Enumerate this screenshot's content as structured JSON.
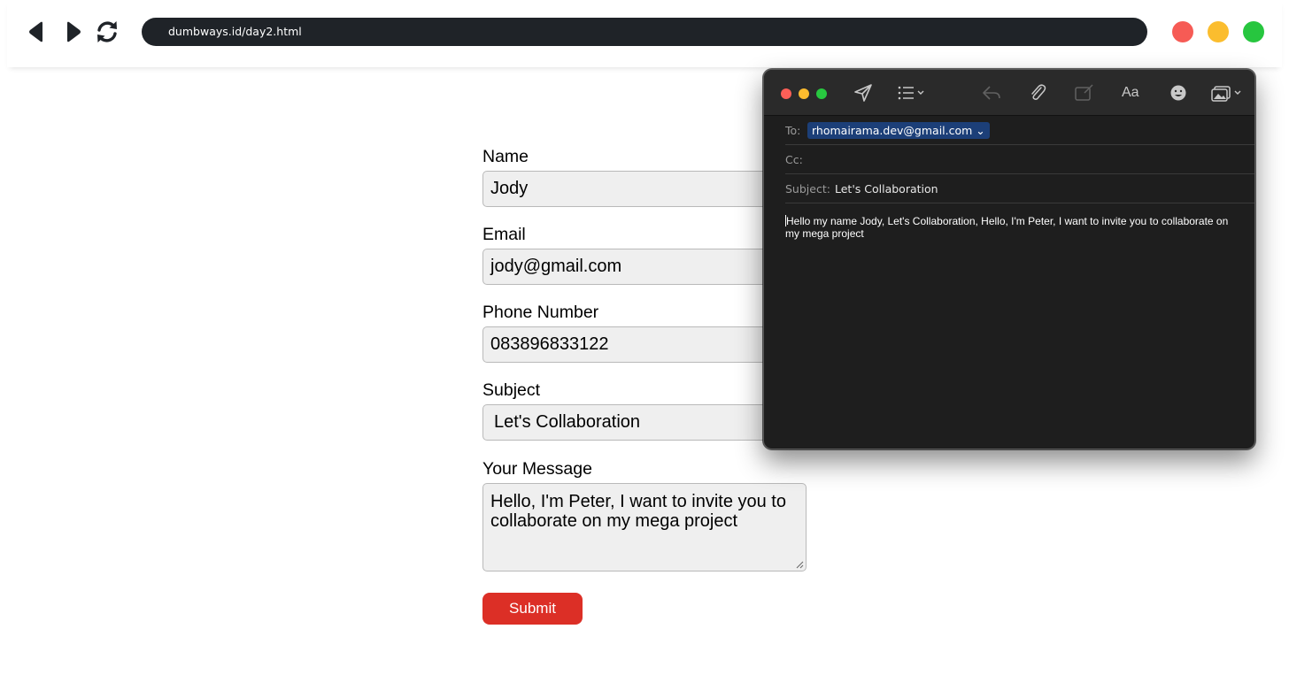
{
  "browser": {
    "url": "dumbways.id/day2.html",
    "window_dots": [
      "#f65b55",
      "#fbbd2e",
      "#27c63f"
    ]
  },
  "form": {
    "name_label": "Name",
    "name_value": "Jody",
    "email_label": "Email",
    "email_value": "jody@gmail.com",
    "phone_label": "Phone Number",
    "phone_value": "083896833122",
    "subject_label": "Subject",
    "subject_value": "Let's Collaboration",
    "message_label": "Your Message",
    "message_value": "Hello, I'm Peter, I want to invite you to collaborate on my mega project",
    "submit_label": "Submit",
    "submit_color": "#dc2f26"
  },
  "mail": {
    "toolbar_icons": [
      "send-icon",
      "list-format-icon",
      "reply-icon",
      "paperclip-icon",
      "markup-icon",
      "font-aa-icon",
      "emoji-icon",
      "photo-browser-icon"
    ],
    "font_button_label": "Aa",
    "to_label": "To:",
    "to_value": "rhomairama.dev@gmail.com",
    "cc_label": "Cc:",
    "cc_value": "",
    "subject_label": "Subject:",
    "subject_value": "Let's Collaboration",
    "body": "Hello my name Jody, Let's Collaboration, Hello, I'm Peter, I want to invite you to collaborate on my mega project"
  }
}
